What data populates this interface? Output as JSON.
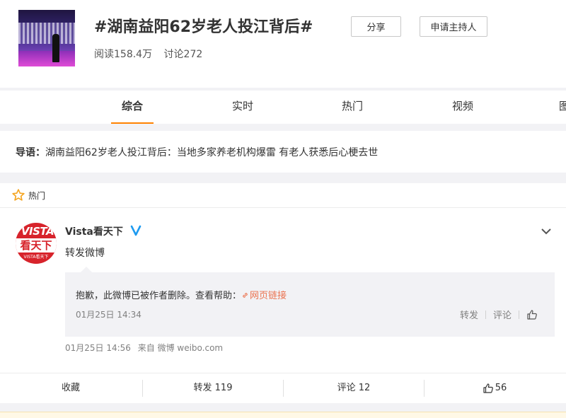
{
  "topic": {
    "title": "#湖南益阳62岁老人投江背后#",
    "reads": "阅读158.4万",
    "discussions": "讨论272",
    "share_label": "分享",
    "apply_host_label": "申请主持人"
  },
  "tabs": [
    {
      "label": "综合",
      "active": true
    },
    {
      "label": "实时",
      "active": false
    },
    {
      "label": "热门",
      "active": false
    },
    {
      "label": "视频",
      "active": false
    },
    {
      "label": "图",
      "active": false
    }
  ],
  "intro": {
    "prefix": "导语：",
    "text": "湖南益阳62岁老人投江背后：当地多家养老机构爆雷 有老人获悉后心梗去世"
  },
  "feed": {
    "section_label": "热门",
    "post": {
      "avatar": {
        "line1": "VISTA",
        "line2": "看天下",
        "line3": "VISTA看天下"
      },
      "user_name": "Vista看天下",
      "text": "转发微博",
      "repost": {
        "deleted_message": "抱歉，此微博已被作者删除。查看帮助：",
        "help_link": "网页链接",
        "time": "01月25日 14:34",
        "forward_label": "转发",
        "comment_label": "评论"
      },
      "time": "01月25日 14:56",
      "source": "来自 微博 weibo.com",
      "actions": {
        "favorite": "收藏",
        "forward": "转发 119",
        "comment": "评论 12",
        "like_count": "56"
      }
    }
  },
  "colors": {
    "accent": "#ff8200",
    "link": "#eb7350",
    "verified": "#1e9bf0",
    "avatar_red": "#d7232b"
  }
}
